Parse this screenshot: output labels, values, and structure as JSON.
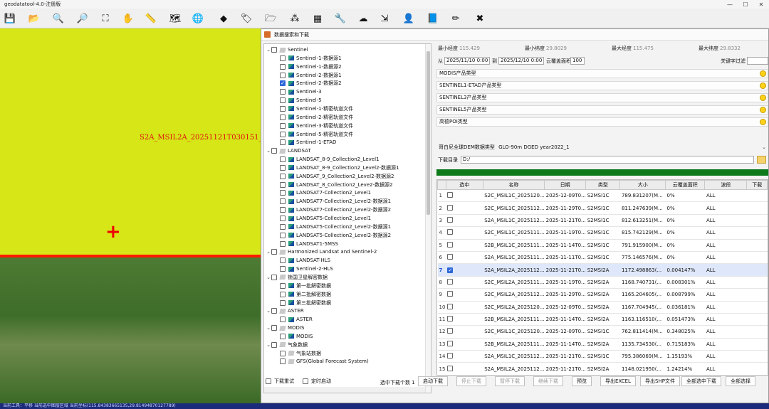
{
  "app": {
    "title": "geodatatool-4.0-注册版",
    "window_controls": [
      "—",
      "☐",
      "✕"
    ]
  },
  "toolbar": {
    "buttons": [
      {
        "icon": "save-icon",
        "glyph": "💾"
      },
      {
        "icon": "open-folder-icon",
        "glyph": "📂"
      },
      {
        "icon": "zoom-in-icon",
        "glyph": "🔍"
      },
      {
        "icon": "zoom-out-icon",
        "glyph": "🔎"
      },
      {
        "icon": "full-extent-icon",
        "glyph": "⛶"
      },
      {
        "icon": "pan-hand-icon",
        "glyph": "✋"
      },
      {
        "icon": "measure-ruler-icon",
        "glyph": "📏"
      },
      {
        "icon": "layers-icon",
        "glyph": "🗺"
      },
      {
        "icon": "tag-icon",
        "glyph": "🏷"
      },
      {
        "icon": "globe-search-icon",
        "glyph": "🌐"
      },
      {
        "icon": "diamond-icon",
        "glyph": "◆"
      },
      {
        "icon": "folder-icon",
        "glyph": "🗁"
      },
      {
        "icon": "network-icon",
        "glyph": "⁂"
      },
      {
        "icon": "grid-icon",
        "glyph": "▦"
      },
      {
        "icon": "wrench-icon",
        "glyph": "🔧"
      },
      {
        "icon": "cloud-icon",
        "glyph": "☁"
      },
      {
        "icon": "export-icon",
        "glyph": "⇲"
      },
      {
        "icon": "user-icon",
        "glyph": "👤"
      },
      {
        "icon": "book-icon",
        "glyph": "📘"
      },
      {
        "icon": "pencil-icon",
        "glyph": "✏"
      },
      {
        "icon": "close-red-icon",
        "glyph": "✖"
      }
    ]
  },
  "map": {
    "label": "S2A_MSIL2A_20251121T030151_N",
    "crosshair": "+"
  },
  "statusbar": {
    "text": "当前工具：平移  当前选中图层区域  当前坐标(115.84383665135,29.81494870127789)"
  },
  "dialog": {
    "title": "数据搜索和下载",
    "tree": [
      {
        "level": 0,
        "expanded": true,
        "label": "Sentinel",
        "checked": false,
        "icon": "folder"
      },
      {
        "level": 1,
        "label": "Sentinel-1-数据源1",
        "checked": false,
        "icon": "leaf"
      },
      {
        "level": 1,
        "label": "Sentinel-1-数据源2",
        "checked": false,
        "icon": "leaf"
      },
      {
        "level": 1,
        "label": "Sentinel-2-数据源1",
        "checked": false,
        "icon": "leaf"
      },
      {
        "level": 1,
        "label": "Sentinel-2-数据源2",
        "checked": true,
        "icon": "leaf"
      },
      {
        "level": 1,
        "label": "Sentinel-3",
        "checked": false,
        "icon": "leaf"
      },
      {
        "level": 1,
        "label": "Sentinel-5",
        "checked": false,
        "icon": "leaf"
      },
      {
        "level": 1,
        "label": "Sentinel-1-精密轨道文件",
        "checked": false,
        "icon": "leaf"
      },
      {
        "level": 1,
        "label": "Sentinel-2-精密轨道文件",
        "checked": false,
        "icon": "leaf"
      },
      {
        "level": 1,
        "label": "Sentinel-3-精密轨道文件",
        "checked": false,
        "icon": "leaf"
      },
      {
        "level": 1,
        "label": "Sentinel-5-精密轨道文件",
        "checked": false,
        "icon": "leaf"
      },
      {
        "level": 1,
        "label": "Sentinel-1-ETAD",
        "checked": false,
        "icon": "leaf"
      },
      {
        "level": 0,
        "expanded": true,
        "label": "LANDSAT",
        "checked": false,
        "icon": "folder"
      },
      {
        "level": 1,
        "label": "LANDSAT_8-9_Collection2_Level1",
        "checked": false,
        "icon": "leaf"
      },
      {
        "level": 1,
        "label": "LANDSAT_8-9_Collection2_Level2-数据源1",
        "checked": false,
        "icon": "leaf"
      },
      {
        "level": 1,
        "label": "LANDSAT_9_Collection2_Level2-数据源2",
        "checked": false,
        "icon": "leaf"
      },
      {
        "level": 1,
        "label": "LANDSAT_8_Collection2_Leve2-数据源2",
        "checked": false,
        "icon": "leaf"
      },
      {
        "level": 1,
        "label": "LANDSAT7-Collection2_Level1",
        "checked": false,
        "icon": "leaf"
      },
      {
        "level": 1,
        "label": "LANDSAT7-Collection2_Level2-数据源1",
        "checked": false,
        "icon": "leaf"
      },
      {
        "level": 1,
        "label": "LANDSAT7-Collection2_Level2-数据源2",
        "checked": false,
        "icon": "leaf"
      },
      {
        "level": 1,
        "label": "LANDSAT5-Collection2_Level1",
        "checked": false,
        "icon": "leaf"
      },
      {
        "level": 1,
        "label": "LANDSAT5-Collection2_Level2-数据源1",
        "checked": false,
        "icon": "leaf"
      },
      {
        "level": 1,
        "label": "LANDSAT5-Collection2_Level2-数据源2",
        "checked": false,
        "icon": "leaf"
      },
      {
        "level": 1,
        "label": "LANDSAT1-5MSS",
        "checked": false,
        "icon": "leaf"
      },
      {
        "level": 0,
        "expanded": true,
        "label": "Harmonized Landsat and Sentinel-2",
        "checked": false,
        "icon": "folder"
      },
      {
        "level": 1,
        "label": "LANDSAT-HLS",
        "checked": false,
        "icon": "leaf"
      },
      {
        "level": 1,
        "label": "Sentinel-2-HLS",
        "checked": false,
        "icon": "leaf"
      },
      {
        "level": 0,
        "expanded": true,
        "label": "锁国卫星解密数据",
        "checked": false,
        "icon": "folder"
      },
      {
        "level": 1,
        "label": "第一批解密数据",
        "checked": false,
        "icon": "leaf"
      },
      {
        "level": 1,
        "label": "第二批解密数据",
        "checked": false,
        "icon": "leaf"
      },
      {
        "level": 1,
        "label": "第三批解密数据",
        "checked": false,
        "icon": "leaf"
      },
      {
        "level": 0,
        "expanded": true,
        "label": "ASTER",
        "checked": false,
        "icon": "folder"
      },
      {
        "level": 1,
        "label": "ASTER",
        "checked": false,
        "icon": "leaf"
      },
      {
        "level": 0,
        "expanded": true,
        "label": "MODIS",
        "checked": false,
        "icon": "folder"
      },
      {
        "level": 1,
        "label": "MODIS",
        "checked": false,
        "icon": "leaf"
      },
      {
        "level": 0,
        "expanded": true,
        "label": "气象数据",
        "checked": false,
        "icon": "folder"
      },
      {
        "level": 1,
        "label": "气象站数据",
        "checked": false,
        "icon": "folder"
      },
      {
        "level": 1,
        "label": "GFS(Global Forecast System)",
        "checked": false,
        "icon": "folder"
      }
    ],
    "bounds": {
      "min_lon_label": "最小经度",
      "min_lon": "115.429",
      "min_lat_label": "最小纬度",
      "min_lat": "29.8029",
      "max_lon_label": "最大经度",
      "max_lon": "115.475",
      "max_lat_label": "最大纬度",
      "max_lat": "29.8332"
    },
    "dates": {
      "from_label": "从",
      "from": "2025/11/10 0:00",
      "to_label": "到",
      "to": "2025/12/10 0:00",
      "cloud_label": "云覆盖面积",
      "cloud": "100",
      "keyword_label": "关键字过滤"
    },
    "categories": [
      "MODIS产品类型",
      "SENTINEL1-ETAD产品类型",
      "SENTINEL3产品类型",
      "SENTINEL5产品类型",
      "高德POI类型"
    ],
    "dem": {
      "label": "哥白尼全球DEM数据类型",
      "value": "GLO-90m DGED year2022_1"
    },
    "download_dir": {
      "label": "下载目录",
      "value": "D:/"
    },
    "progress": 1.0,
    "columns": [
      "",
      "选中",
      "名称",
      "日期",
      "类型",
      "大小",
      "云覆盖面积",
      "波段",
      "下载"
    ],
    "rows": [
      {
        "n": "1",
        "checked": false,
        "name": "S2C_MSIL1C_2025120...",
        "date": "2025-12-09T0...",
        "type": "S2MSI1C",
        "size": "789.831207(M...",
        "cloud": "0%",
        "band": "ALL"
      },
      {
        "n": "2",
        "checked": false,
        "name": "S2C_MSIL1C_2025112...",
        "date": "2025-11-29T0...",
        "type": "S2MSI1C",
        "size": "811.247639(M...",
        "cloud": "0%",
        "band": "ALL"
      },
      {
        "n": "3",
        "checked": false,
        "name": "S2A_MSIL1C_2025112...",
        "date": "2025-11-21T0...",
        "type": "S2MSI1C",
        "size": "812.613251(M...",
        "cloud": "0%",
        "band": "ALL"
      },
      {
        "n": "4",
        "checked": false,
        "name": "S2C_MSIL1C_2025111...",
        "date": "2025-11-19T0...",
        "type": "S2MSI1C",
        "size": "815.742129(M...",
        "cloud": "0%",
        "band": "ALL"
      },
      {
        "n": "5",
        "checked": false,
        "name": "S2B_MSIL1C_2025111...",
        "date": "2025-11-14T0...",
        "type": "S2MSI1C",
        "size": "791.915900(M...",
        "cloud": "0%",
        "band": "ALL"
      },
      {
        "n": "6",
        "checked": false,
        "name": "S2A_MSIL1C_2025111...",
        "date": "2025-11-11T0...",
        "type": "S2MSI1C",
        "size": "775.146576(M...",
        "cloud": "0%",
        "band": "ALL"
      },
      {
        "n": "7",
        "checked": true,
        "name": "S2A_MSIL2A_2025112...",
        "date": "2025-11-21T0...",
        "type": "S2MSI2A",
        "size": "1172.498863(...",
        "cloud": "0.004147%",
        "band": "ALL"
      },
      {
        "n": "8",
        "checked": false,
        "name": "S2C_MSIL2A_2025111...",
        "date": "2025-11-19T0...",
        "type": "S2MSI2A",
        "size": "1168.740731(...",
        "cloud": "0.008301%",
        "band": "ALL"
      },
      {
        "n": "9",
        "checked": false,
        "name": "S2C_MSIL2A_2025112...",
        "date": "2025-11-29T0...",
        "type": "S2MSI2A",
        "size": "1165.204605(...",
        "cloud": "0.008799%",
        "band": "ALL"
      },
      {
        "n": "10",
        "checked": false,
        "name": "S2C_MSIL2A_2025120...",
        "date": "2025-12-09T0...",
        "type": "S2MSI2A",
        "size": "1167.704945(...",
        "cloud": "0.036181%",
        "band": "ALL"
      },
      {
        "n": "11",
        "checked": false,
        "name": "S2B_MSIL2A_2025111...",
        "date": "2025-11-14T0...",
        "type": "S2MSI2A",
        "size": "1163.116510(...",
        "cloud": "0.051473%",
        "band": "ALL"
      },
      {
        "n": "12",
        "checked": false,
        "name": "S2C_MSIL1C_2025120...",
        "date": "2025-12-09T0...",
        "type": "S2MSI1C",
        "size": "762.811414(M...",
        "cloud": "0.348025%",
        "band": "ALL"
      },
      {
        "n": "13",
        "checked": false,
        "name": "S2B_MSIL2A_2025111...",
        "date": "2025-11-14T0...",
        "type": "S2MSI2A",
        "size": "1135.734530(...",
        "cloud": "0.715183%",
        "band": "ALL"
      },
      {
        "n": "14",
        "checked": false,
        "name": "S2A_MSIL1C_2025112...",
        "date": "2025-11-21T0...",
        "type": "S2MSI1C",
        "size": "795.386069(M...",
        "cloud": "1.15193%",
        "band": "ALL"
      },
      {
        "n": "15",
        "checked": false,
        "name": "S2A_MSIL2A_2025112...",
        "date": "2025-11-21T0...",
        "type": "S2MSI2A",
        "size": "1148.021950(...",
        "cloud": "1.24214%",
        "band": "ALL"
      }
    ],
    "bottom": {
      "retry_label": "下载重试",
      "schedule_label": "定时启动",
      "selected_count": "选中下载个数 1",
      "buttons": [
        "启动下载",
        "停止下载",
        "暂停下载",
        "继续下载",
        "预览",
        "导出EXCEL",
        "导出SHP文件",
        "全部选中下载",
        "全部选择"
      ]
    }
  }
}
